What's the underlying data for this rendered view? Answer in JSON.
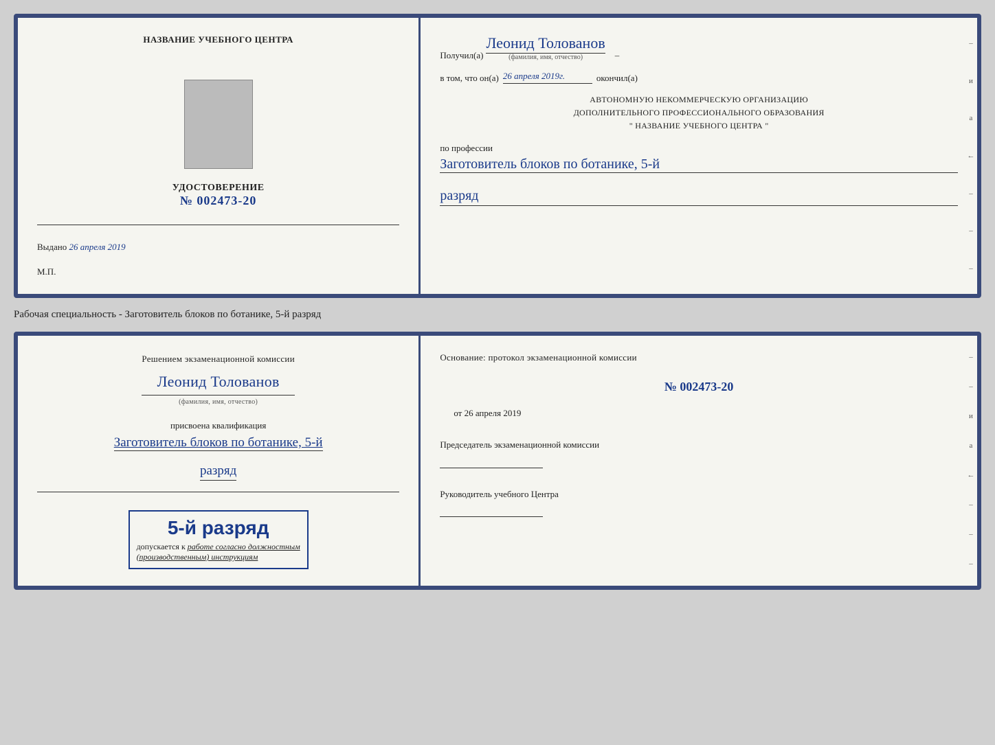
{
  "upper_cert": {
    "left": {
      "training_center_title": "НАЗВАНИЕ УЧЕБНОГО ЦЕНТРА",
      "udostoverenie_label": "УДОСТОВЕРЕНИЕ",
      "cert_number": "№ 002473-20",
      "vydano_prefix": "Выдано",
      "vydano_date": "26 апреля 2019",
      "mp_label": "М.П."
    },
    "right": {
      "poluchil_prefix": "Получил(а)",
      "recipient_name": "Леонид Толованов",
      "fio_label": "(фамилия, имя, отчество)",
      "vtom_prefix": "в том, что он(а)",
      "vtom_date": "26 апреля 2019г.",
      "okonchil_suffix": "окончил(а)",
      "org_line1": "АВТОНОМНУЮ НЕКОММЕРЧЕСКУЮ ОРГАНИЗАЦИЮ",
      "org_line2": "ДОПОЛНИТЕЛЬНОГО ПРОФЕССИОНАЛЬНОГО ОБРАЗОВАНИЯ",
      "org_line3": "\"    НАЗВАНИЕ УЧЕБНОГО ЦЕНТРА    \"",
      "po_professii_label": "по профессии",
      "profession": "Заготовитель блоков по ботанике, 5-й",
      "razryad": "разряд"
    }
  },
  "specialty_label": "Рабочая специальность - Заготовитель блоков по ботанике, 5-й разряд",
  "lower_cert": {
    "left": {
      "resheniem_label": "Решением экзаменационной комиссии",
      "recipient_name": "Леонид Толованов",
      "fio_label": "(фамилия, имя, отчество)",
      "prisvoena_label": "присвоена квалификация",
      "qualification": "Заготовитель блоков по ботанике, 5-й",
      "razryad": "разряд",
      "razryad_big": "5-й разряд",
      "dopusk_prefix": "допускается к",
      "dopusk_italic": "работе согласно должностным",
      "dopusk_italic2": "(производственным) инструкциям"
    },
    "right": {
      "osnovanie_label": "Основание: протокол экзаменационной комиссии",
      "protocol_number": "№  002473-20",
      "ot_prefix": "от",
      "ot_date": "26 апреля 2019",
      "predsedatel_label": "Председатель экзаменационной комиссии",
      "rukovoditel_label": "Руководитель учебного Центра"
    }
  },
  "side_marks": {
    "letters": [
      "и",
      "а",
      "←",
      "–",
      "–",
      "–",
      "–"
    ]
  }
}
